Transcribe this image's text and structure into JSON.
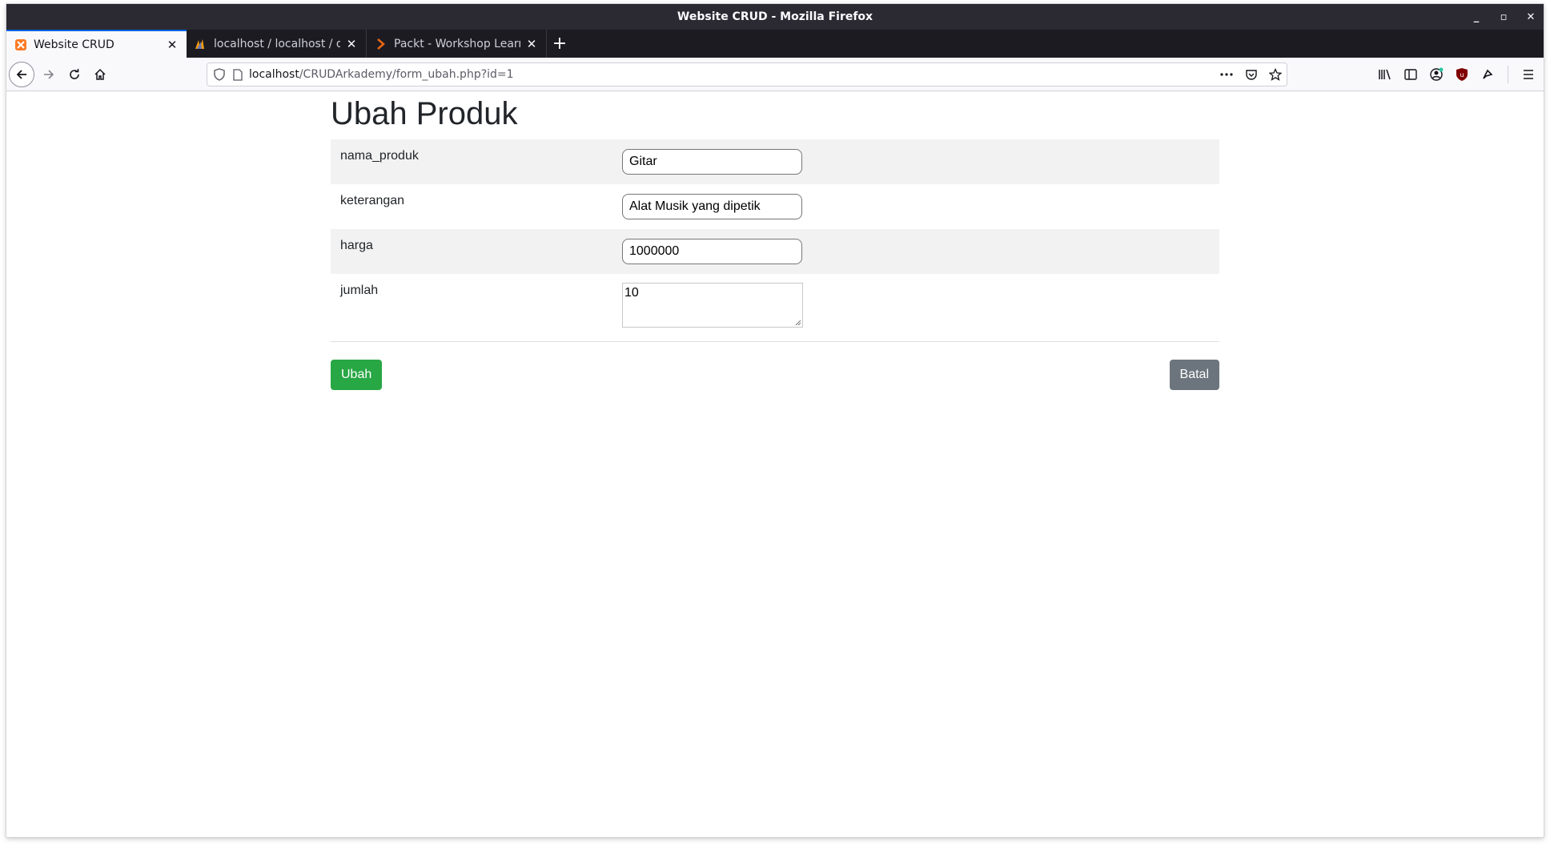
{
  "window": {
    "title": "Website CRUD - Mozilla Firefox",
    "controls": {
      "minimize": "_",
      "maximize": "▫",
      "close": "✕"
    }
  },
  "tabs": [
    {
      "label": "Website CRUD",
      "icon": "xampp-icon",
      "active": true
    },
    {
      "label": "localhost / localhost / db",
      "icon": "phpmyadmin-icon",
      "active": false
    },
    {
      "label": "Packt - Workshop Learnin",
      "icon": "packt-icon",
      "active": false
    }
  ],
  "tab_close_glyph": "✕",
  "new_tab_glyph": "+",
  "navbar": {
    "url_host": "localhost",
    "url_path": "/CRUDArkademy/form_ubah.php?id=1"
  },
  "page": {
    "heading": "Ubah Produk",
    "fields": [
      {
        "label": "nama_produk",
        "value": "Gitar",
        "type": "input"
      },
      {
        "label": "keterangan",
        "value": "Alat Musik yang dipetik",
        "type": "input"
      },
      {
        "label": "harga",
        "value": "1000000",
        "type": "input"
      },
      {
        "label": "jumlah",
        "value": "10",
        "type": "textarea"
      }
    ],
    "submit_label": "Ubah",
    "cancel_label": "Batal"
  },
  "colors": {
    "success": "#28a745",
    "secondary": "#6c757d",
    "title_bar": "#2b2a33",
    "tab_accent": "#0060df"
  }
}
